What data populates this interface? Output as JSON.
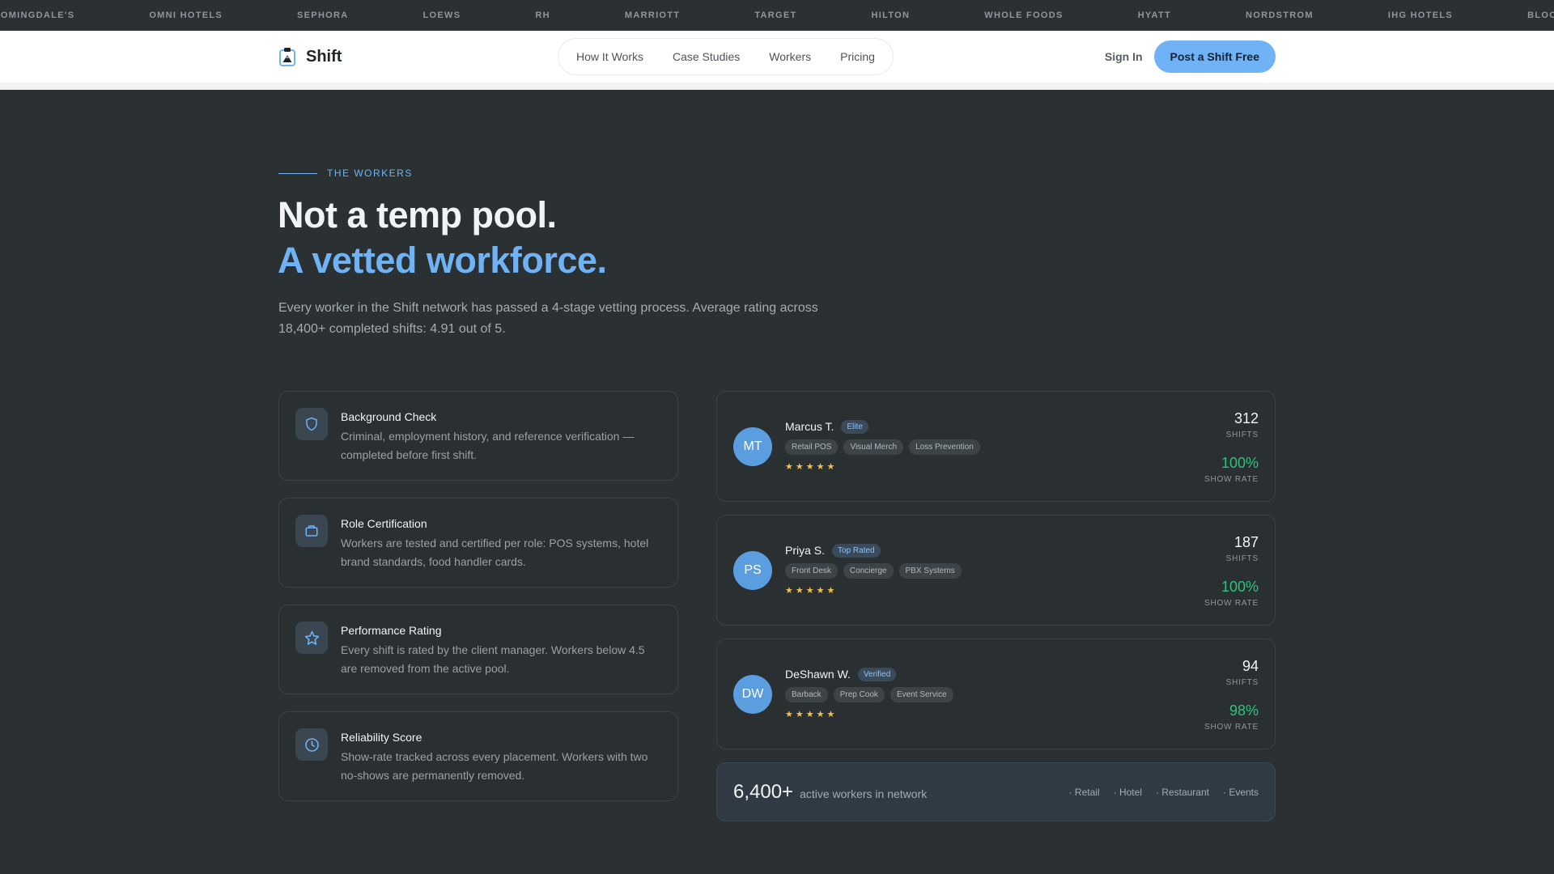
{
  "ticker": [
    "OOMINGDALE'S",
    "OMNI HOTELS",
    "SEPHORA",
    "LOEWS",
    "RH",
    "MARRIOTT",
    "TARGET",
    "HILTON",
    "WHOLE FOODS",
    "HYATT",
    "NORDSTROM",
    "IHG HOTELS",
    "BLOOMINGDALE'S"
  ],
  "nav": {
    "brand": "Shift",
    "links": [
      "How It Works",
      "Case Studies",
      "Workers",
      "Pricing"
    ],
    "sign_in": "Sign In",
    "cta": "Post a Shift Free"
  },
  "hero": {
    "eyebrow": "THE WORKERS",
    "title_line1": "Not a temp pool.",
    "title_line2": "A vetted workforce.",
    "lead": "Every worker in the Shift network has passed a 4-stage vetting process. Average rating across 18,400+ completed shifts: 4.91 out of 5."
  },
  "steps": [
    {
      "icon": "shield-icon",
      "title": "Background Check",
      "desc": "Criminal, employment history, and reference verification — completed before first shift."
    },
    {
      "icon": "briefcase-icon",
      "title": "Role Certification",
      "desc": "Workers are tested and certified per role: POS systems, hotel brand standards, food handler cards."
    },
    {
      "icon": "star-icon",
      "title": "Performance Rating",
      "desc": "Every shift is rated by the client manager. Workers below 4.5 are removed from the active pool."
    },
    {
      "icon": "clock-icon",
      "title": "Reliability Score",
      "desc": "Show-rate tracked across every placement. Workers with two no-shows are permanently removed."
    }
  ],
  "workers": [
    {
      "initials": "MT",
      "name": "Marcus T.",
      "badge": "Elite",
      "skills": [
        "Retail POS",
        "Visual Merch",
        "Loss Prevention"
      ],
      "rating": 5,
      "shifts": "312",
      "shifts_label": "SHIFTS",
      "show_rate": "100%",
      "show_rate_label": "SHOW RATE"
    },
    {
      "initials": "PS",
      "name": "Priya S.",
      "badge": "Top Rated",
      "skills": [
        "Front Desk",
        "Concierge",
        "PBX Systems"
      ],
      "rating": 5,
      "shifts": "187",
      "shifts_label": "SHIFTS",
      "show_rate": "100%",
      "show_rate_label": "SHOW RATE"
    },
    {
      "initials": "DW",
      "name": "DeShawn W.",
      "badge": "Verified",
      "skills": [
        "Barback",
        "Prep Cook",
        "Event Service"
      ],
      "rating": 5,
      "shifts": "94",
      "shifts_label": "SHIFTS",
      "show_rate": "98%",
      "show_rate_label": "SHOW RATE"
    }
  ],
  "network": {
    "count": "6,400+",
    "label": "active workers in network",
    "tags": [
      "· Retail",
      "· Hotel",
      "· Restaurant",
      "· Events"
    ]
  },
  "colors": {
    "accent": "#6fb3f6",
    "success": "#2ec27e",
    "star": "#f2c14e",
    "background": "#2b3133"
  }
}
